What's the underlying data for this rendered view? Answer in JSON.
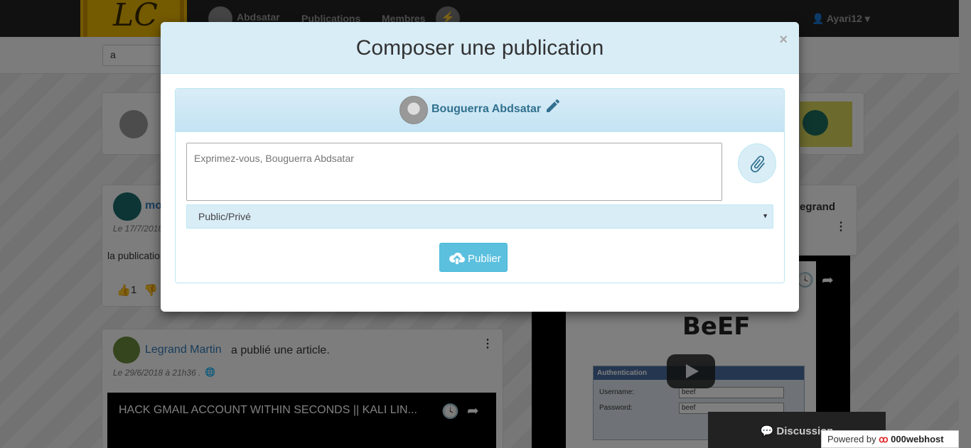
{
  "navbar": {
    "logo_text": "LC",
    "profile_name": "Abdsatar",
    "links": [
      "Publications",
      "Membres"
    ],
    "user_menu": "Ayari12"
  },
  "search": {
    "value": "a"
  },
  "posts": [
    {
      "name": "mo",
      "meta": "Le 17/7/2018",
      "text": "la publicatio",
      "likes": "1"
    },
    {
      "name": "Legrand Martin",
      "action": "a publié une article.",
      "meta": "Le 29/6/2018 à 21h36 .",
      "video_title": "HACK GMAIL ACCOUNT WITHIN SECONDS || KALI LIN..."
    }
  ],
  "right_card": {
    "name": "egrand"
  },
  "video_auth": {
    "title": "Authentication",
    "username_label": "Username:",
    "password_label": "Password:",
    "username_value": "beef",
    "password_value": "beef",
    "brand": "BeEF"
  },
  "discussion": {
    "label": "Discussion"
  },
  "powered": {
    "prefix": "Powered by",
    "brand": "000webhost"
  },
  "modal": {
    "title": "Composer une publication",
    "close": "×",
    "author": "Bouguerra Abdsatar",
    "textarea_placeholder": "Exprimez-vous, Bouguerra Abdsatar",
    "visibility_selected": "Public/Privé",
    "publish_label": "Publier"
  },
  "colors": {
    "accent": "#5bc0de",
    "header_bg": "#d9edf7",
    "link": "#31708f"
  }
}
